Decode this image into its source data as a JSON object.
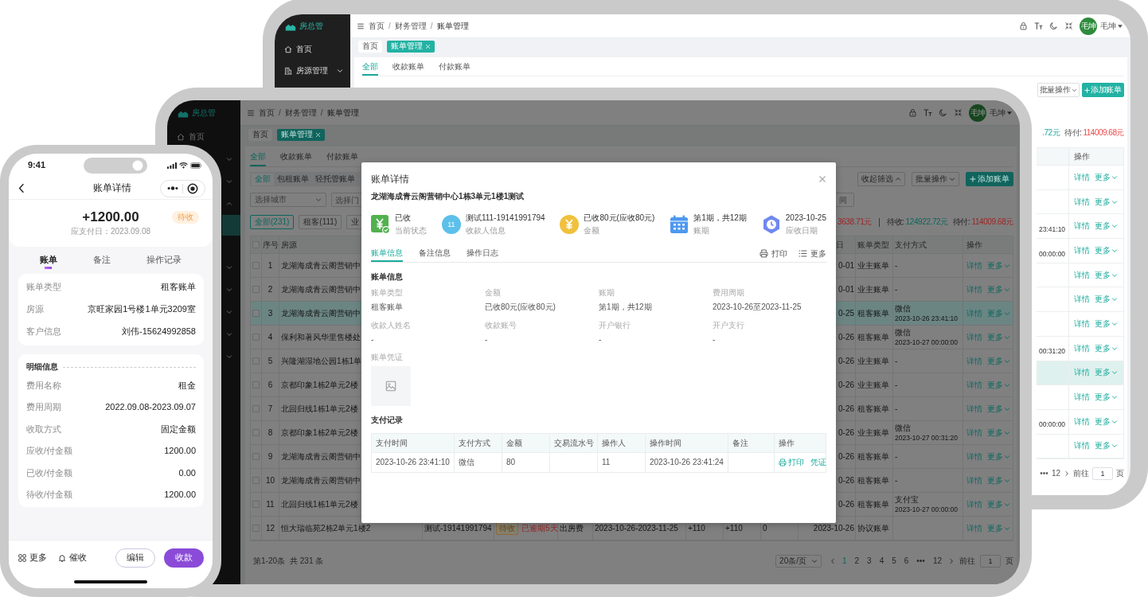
{
  "back_screen": {
    "logo": "房总管",
    "sidebar": [
      {
        "kind": "home",
        "label": "首页"
      },
      {
        "kind": "group",
        "label": "房源管理",
        "expanded": false
      }
    ],
    "breadcrumb": {
      "separator": "/",
      "items": [
        "首页",
        "财务管理",
        "账单管理"
      ]
    },
    "user": {
      "avatar": "毛坤",
      "name": "毛坤"
    },
    "page_tabs": [
      {
        "label": "首页",
        "selected": false,
        "closable": false
      },
      {
        "label": "账单管理",
        "selected": true,
        "closable": true
      }
    ],
    "tabs": [
      {
        "label": "全部",
        "selected": true
      },
      {
        "label": "收款账单",
        "selected": false
      },
      {
        "label": "付款账单",
        "selected": false
      }
    ],
    "toolbar": [
      {
        "kind": "dropdown",
        "label": "批量操作"
      },
      {
        "kind": "primary",
        "label": "添加账单"
      }
    ],
    "balances": [
      {
        "kind": "income",
        "value": ".72元"
      },
      {
        "kind": "expense",
        "label": "待付:",
        "value": "114009.68元"
      }
    ],
    "table": {
      "action_header": "操作",
      "rows": [
        {
          "actions": [
            "详情",
            "更多"
          ],
          "selected": false
        },
        {
          "actions": [
            "详情",
            "更多"
          ],
          "selected": false
        },
        {
          "time": "23:41:10",
          "actions": [
            "详情",
            "更多"
          ],
          "selected": false
        },
        {
          "time": "00:00:00",
          "actions": [
            "详情",
            "更多"
          ],
          "selected": false
        },
        {
          "actions": [
            "详情",
            "更多"
          ],
          "selected": false
        },
        {
          "actions": [
            "详情",
            "更多"
          ],
          "selected": false
        },
        {
          "actions": [
            "详情",
            "更多"
          ],
          "selected": false
        },
        {
          "time": "00:31:20",
          "actions": [
            "详情",
            "更多"
          ],
          "selected": false
        },
        {
          "actions": [
            "详情",
            "更多"
          ],
          "selected": true
        },
        {
          "actions": [
            "详情",
            "更多"
          ],
          "selected": false
        },
        {
          "time": "00:00:00",
          "actions": [
            "详情",
            "更多"
          ],
          "selected": false
        },
        {
          "actions": [
            "详情",
            "更多"
          ],
          "selected": false
        }
      ]
    },
    "pagination": {
      "ellipsis": "•••",
      "last_page": "12",
      "goto_label": "前往",
      "goto_value": "1",
      "goto_unit": "页"
    }
  },
  "main_screen": {
    "logo": "房总管",
    "home_item": "首页",
    "menu": [
      {
        "kind": "group",
        "expanded": false
      },
      {
        "kind": "group",
        "expanded": false
      },
      {
        "kind": "group",
        "expanded": true
      },
      {
        "kind": "child",
        "selected": true
      },
      {
        "kind": "group",
        "expanded": false
      },
      {
        "kind": "group",
        "expanded": false
      },
      {
        "kind": "group",
        "expanded": false
      },
      {
        "kind": "group",
        "expanded": false
      },
      {
        "kind": "group",
        "expanded": false
      }
    ],
    "breadcrumb": {
      "separator": "/",
      "items": [
        "首页",
        "财务管理",
        "账单管理"
      ]
    },
    "user": {
      "avatar": "毛坤",
      "name": "毛坤"
    },
    "page_tabs": [
      {
        "label": "首页",
        "selected": false,
        "closable": false
      },
      {
        "label": "账单管理",
        "selected": true,
        "closable": true
      }
    ],
    "tabs": [
      {
        "label": "全部",
        "selected": true
      },
      {
        "label": "收款账单",
        "selected": false
      },
      {
        "label": "付款账单",
        "selected": false
      }
    ],
    "type_tabs": [
      {
        "label": "全部",
        "selected": true
      },
      {
        "label": "包租账单",
        "selected": false
      },
      {
        "label": "轻托管账单",
        "selected": false
      }
    ],
    "toolbar": [
      {
        "kind": "toggle",
        "label": "收起筛选",
        "expanded": true
      },
      {
        "kind": "dropdown",
        "label": "批量操作"
      },
      {
        "kind": "primary",
        "label": "添加账单"
      }
    ],
    "filters": [
      {
        "kind": "select",
        "placeholder": "选择城市"
      },
      {
        "kind": "input",
        "placeholder": "选择门"
      },
      {
        "kind": "input",
        "placeholder": "间"
      }
    ],
    "count_tabs": [
      {
        "label": "全部(231)",
        "selected": true
      },
      {
        "label": "租客(111)",
        "selected": false
      },
      {
        "label": "业",
        "selected": false
      }
    ],
    "totals": [
      {
        "kind": "expense",
        "value": "3638.71元"
      }
    ],
    "balances": [
      {
        "kind": "income",
        "label": "待收:",
        "value": "124922.72元"
      },
      {
        "kind": "expense",
        "label": "待付:",
        "value": "114009.68元"
      }
    ],
    "table": {
      "header_checked": false,
      "header": {
        "no": "序号",
        "source": "房源",
        "column_11": "日",
        "bill_type": "账单类型",
        "payment": "支付方式",
        "actions": "操作"
      },
      "rows": [
        {
          "checked": false,
          "selected": false,
          "no": "1",
          "source": "龙湖海成青云阁营销中",
          "column_11": "0-01",
          "bill_type": "业主账单",
          "payment": "-",
          "actions": [
            "详情",
            "更多"
          ]
        },
        {
          "checked": false,
          "selected": false,
          "no": "2",
          "source": "龙湖海成青云阁营销中",
          "column_11": "0-01",
          "bill_type": "业主账单",
          "payment": "-",
          "actions": [
            "详情",
            "更多"
          ]
        },
        {
          "checked": false,
          "selected": true,
          "no": "3",
          "source": "龙湖海成青云阁营销中",
          "column_11": "0-25",
          "bill_type": "租客账单",
          "payment": "微信",
          "payment_time": "2023-10-26 23:41:10",
          "actions": [
            "详情",
            "更多"
          ]
        },
        {
          "checked": false,
          "selected": false,
          "no": "4",
          "source": "保利和著风华里售楼处",
          "column_11": "0-26",
          "bill_type": "租客账单",
          "payment": "微信",
          "payment_time": "2023-10-27 00:00:00",
          "actions": [
            "详情",
            "更多"
          ]
        },
        {
          "checked": false,
          "selected": false,
          "no": "5",
          "source": "兴隆湖湿地公园1栋1单",
          "column_11": "0-26",
          "bill_type": "业主账单",
          "payment": "-",
          "actions": [
            "详情",
            "更多"
          ]
        },
        {
          "checked": false,
          "selected": false,
          "no": "6",
          "source": "京都印象1栋2单元2楼",
          "column_11": "0-26",
          "bill_type": "业主账单",
          "payment": "-",
          "actions": [
            "详情",
            "更多"
          ]
        },
        {
          "checked": false,
          "selected": false,
          "no": "7",
          "source": "北回归线1栋1单元2楼",
          "column_11": "0-26",
          "bill_type": "租客账单",
          "payment": "-",
          "actions": [
            "详情",
            "更多"
          ]
        },
        {
          "checked": false,
          "selected": false,
          "no": "8",
          "source": "京都印象1栋2单元2楼",
          "column_11": "0-26",
          "bill_type": "业主账单",
          "payment": "微信",
          "payment_time": "2023-10-27 00:31:20",
          "actions": [
            "详情",
            "更多"
          ]
        },
        {
          "checked": false,
          "selected": false,
          "no": "9",
          "source": "龙湖海成青云阁营销中",
          "column_11": "0-26",
          "bill_type": "租客账单",
          "payment": "-",
          "actions": [
            "详情",
            "更多"
          ]
        },
        {
          "checked": false,
          "selected": false,
          "no": "10",
          "source": "龙湖海成青云阁营销中",
          "column_11": "0-26",
          "bill_type": "租客账单",
          "payment": "-",
          "actions": [
            "详情",
            "更多"
          ]
        },
        {
          "checked": false,
          "selected": false,
          "no": "11",
          "source": "北回归线1栋1单元2楼",
          "column_11": "0-26",
          "bill_type": "租客账单",
          "payment": "支付宝",
          "payment_time": "2023-10-27 00:00:00",
          "actions": [
            "详情",
            "更多"
          ]
        },
        {
          "checked": false,
          "selected": false,
          "no": "12",
          "source": "恒大瑞临苑2栋2单元1楼2",
          "column_4": "测试-19141991794",
          "column_5": {
            "badge": "待收",
            "text": "已逾期5天"
          },
          "column_6": "出房费",
          "column_7": "2023-10-26-2023-11-25",
          "column_8": "+110",
          "column_9": "+110",
          "column_10": "0",
          "column_11": "2023-10-26",
          "bill_type": "协议账单",
          "actions": [
            "详情",
            "更多"
          ]
        }
      ]
    },
    "pagination": {
      "range": "第1-20条",
      "total": "共 231 条",
      "page_size": "20条/页",
      "pages": [
        {
          "label": "1",
          "selected": true
        },
        {
          "label": "2",
          "selected": false
        },
        {
          "label": "3",
          "selected": false
        },
        {
          "label": "4",
          "selected": false
        },
        {
          "label": "5",
          "selected": false
        },
        {
          "label": "6",
          "selected": false
        }
      ],
      "ellipsis": "•••",
      "last_page": "12",
      "goto_label": "前往",
      "goto_value": "1",
      "goto_unit": "页"
    }
  },
  "detail_modal": {
    "title": "账单详情",
    "subtitle": "龙湖海成青云阁营销中心1栋3单元1楼1测试",
    "highlights": [
      {
        "kind": "status",
        "value": "已收",
        "caption": "当前状态"
      },
      {
        "kind": "payee",
        "badge": "11",
        "value": "测试111-19141991794",
        "caption": "收款人信息"
      },
      {
        "kind": "amount",
        "value": "已收80元(应收80元)",
        "caption": "金额"
      },
      {
        "kind": "period",
        "value": "第1期，共12期",
        "caption": "账期"
      },
      {
        "kind": "due_date",
        "value": "2023-10-25",
        "caption": "应收日期"
      }
    ],
    "tabs": [
      {
        "label": "账单信息",
        "selected": true
      },
      {
        "label": "备注信息",
        "selected": false
      },
      {
        "label": "操作日志",
        "selected": false
      }
    ],
    "actions": [
      {
        "kind": "print",
        "label": "打印"
      },
      {
        "kind": "more",
        "label": "更多"
      }
    ],
    "section_title": "账单信息",
    "fields": [
      {
        "label": "账单类型",
        "value": "租客账单"
      },
      {
        "label": "金额",
        "value": "已收80元(应收80元)"
      },
      {
        "label": "账期",
        "value": "第1期，共12期"
      },
      {
        "label": "费用周期",
        "value": "2023-10-26至2023-11-25"
      },
      {
        "label": "收款人姓名",
        "value": "-"
      },
      {
        "label": "收款账号",
        "value": "-"
      },
      {
        "label": "开户银行",
        "value": "-"
      },
      {
        "label": "开户支行",
        "value": "-"
      }
    ],
    "voucher_label": "账单凭证",
    "payments_title": "支付记录",
    "payments": {
      "columns": [
        "支付时间",
        "支付方式",
        "金额",
        "交易流水号",
        "操作人",
        "操作时间",
        "备注",
        "操作"
      ],
      "rows": [
        {
          "pay_time": "2023-10-26 23:41:10",
          "method": "微信",
          "amount": "80",
          "operator": "11",
          "op_time": "2023-10-26 23:41:24",
          "actions": [
            {
              "kind": "print",
              "label": "打印"
            },
            {
              "kind": "voucher",
              "label": "凭证"
            }
          ]
        }
      ]
    }
  },
  "phone": {
    "time": "9:41",
    "title": "账单详情",
    "amount": "+1200.00",
    "status": "待收",
    "due": "应支付日：2023.09.08",
    "tabs": [
      {
        "label": "账单",
        "selected": true
      },
      {
        "label": "备注",
        "selected": false
      },
      {
        "label": "操作记录",
        "selected": false
      }
    ],
    "summary_rows": [
      {
        "label": "账单类型",
        "value": "租客账单"
      },
      {
        "label": "房源",
        "value": "京旺家园1号楼1单元3209室"
      },
      {
        "label": "客户信息",
        "value": "刘伟-15624992858"
      }
    ],
    "detail_title": "明细信息",
    "detail_rows": [
      {
        "label": "费用名称",
        "value": "租金"
      },
      {
        "label": "费用周期",
        "value": "2022.09.08-2023.09.07"
      },
      {
        "label": "收取方式",
        "value": "固定金额"
      },
      {
        "label": "应收/付金额",
        "value": "1200.00"
      },
      {
        "label": "已收/付金额",
        "value": "0.00"
      },
      {
        "label": "待收/付金额",
        "value": "1200.00"
      }
    ],
    "footer_actions": [
      {
        "kind": "more",
        "label": "更多"
      },
      {
        "kind": "remind",
        "label": "催收"
      }
    ],
    "buttons": [
      {
        "kind": "secondary",
        "label": "编辑"
      },
      {
        "kind": "primary",
        "label": "收款"
      }
    ]
  }
}
